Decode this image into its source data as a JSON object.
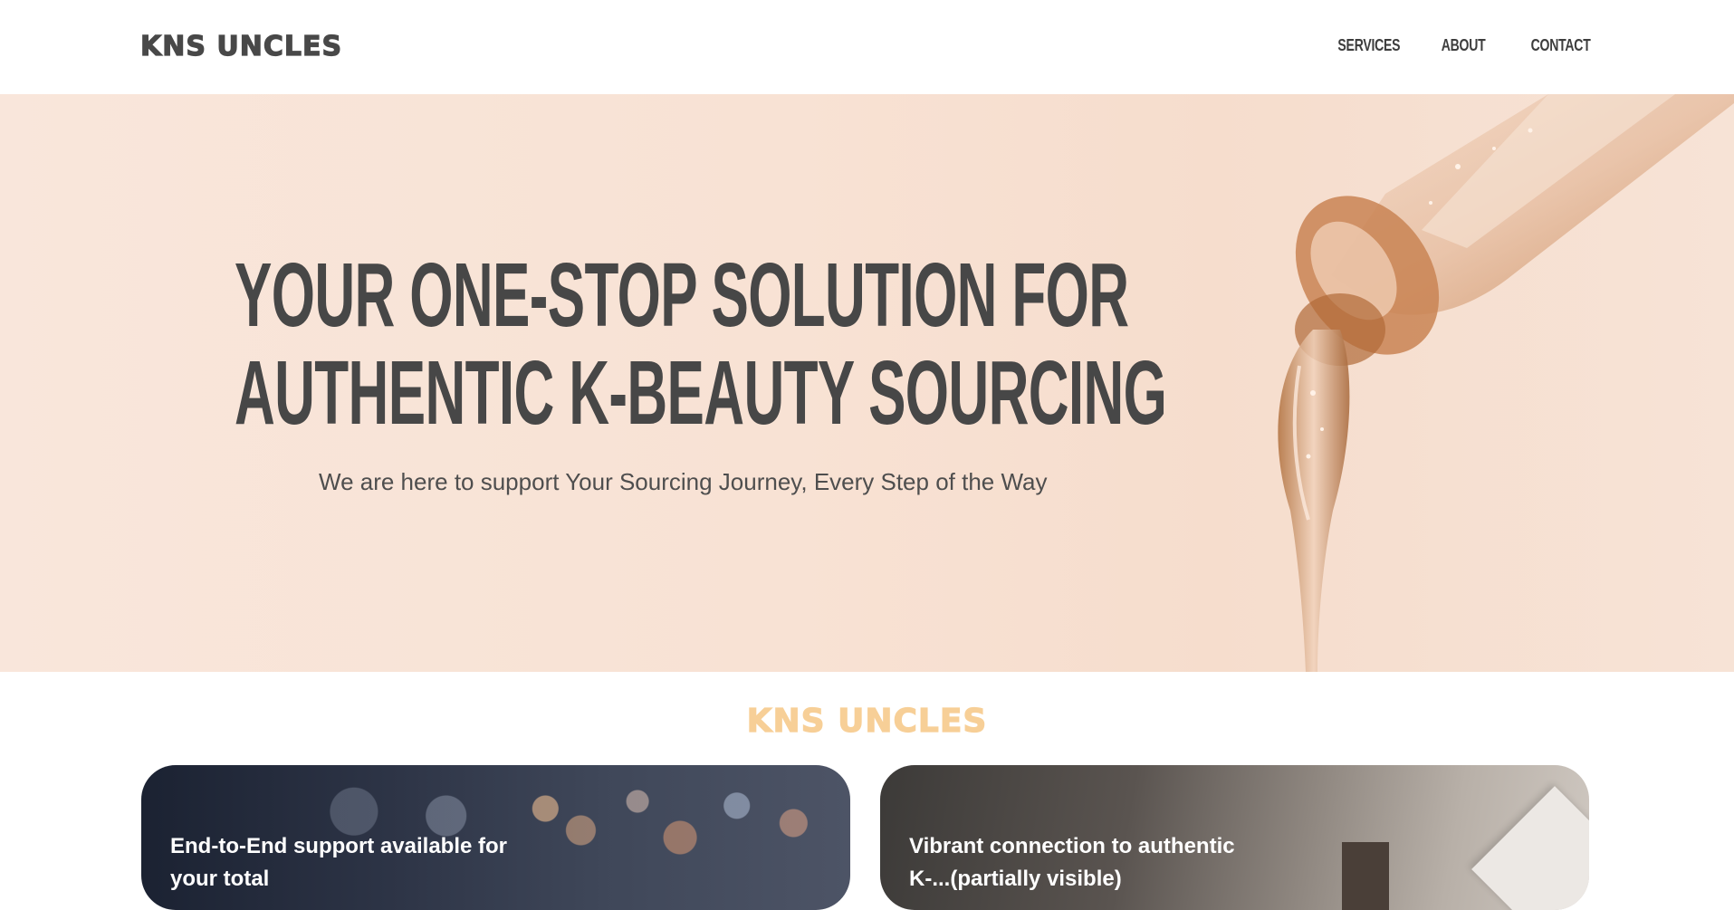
{
  "header": {
    "logo": "KNS UNCLES",
    "nav": [
      {
        "label": "SERVICES"
      },
      {
        "label": "ABOUT"
      },
      {
        "label": "CONTACT"
      }
    ]
  },
  "hero": {
    "title_line1": "YOUR ONE-STOP SOLUTION FOR",
    "title_line2": "AUTHENTIC K-BEAUTY SOURCING",
    "subtitle": "We are here to support Your Sourcing Journey, Every Step of the Way",
    "image": "serum-dropper-image"
  },
  "section": {
    "title": "KNS UNCLES",
    "cards": [
      {
        "text": "End-to-End support available for your total"
      },
      {
        "text": "Vibrant connection to authentic K-...(partially visible)"
      }
    ]
  },
  "colors": {
    "text_dark": "#474747",
    "accent": "#f7cf97",
    "hero_bg": "#f8e2d4"
  }
}
